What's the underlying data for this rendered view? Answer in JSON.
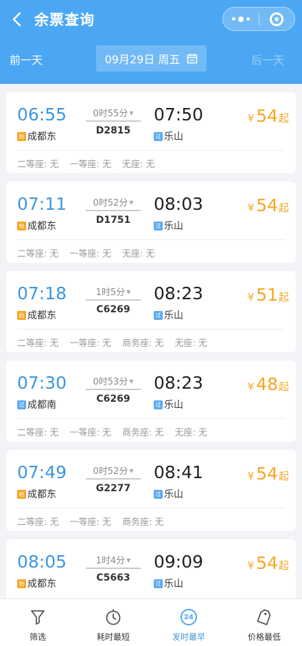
{
  "header": {
    "title": "余票查询",
    "back_icon": "chevron-left-icon",
    "more_icon": "more-dots-icon",
    "close_icon": "target-close-icon"
  },
  "date_nav": {
    "prev_label": "前一天",
    "date_label": "09月29日 周五",
    "calendar_icon": "calendar-icon",
    "next_label": "后一天"
  },
  "trains": [
    {
      "dep_time": "06:55",
      "dep_tag": "始",
      "dep_station": "成都东",
      "duration": "0时55分",
      "train_no": "D2815",
      "arr_time": "07:50",
      "arr_tag": "过",
      "arr_station": "乐山",
      "price_symbol": "¥",
      "price": "54",
      "price_suffix": "起",
      "seats": [
        "二等座: 无",
        "一等座: 无",
        "无座: 无"
      ]
    },
    {
      "dep_time": "07:11",
      "dep_tag": "始",
      "dep_station": "成都东",
      "duration": "0时52分",
      "train_no": "D1751",
      "arr_time": "08:03",
      "arr_tag": "过",
      "arr_station": "乐山",
      "price_symbol": "¥",
      "price": "54",
      "price_suffix": "起",
      "seats": [
        "二等座: 无",
        "一等座: 无",
        "无座: 无"
      ]
    },
    {
      "dep_time": "07:18",
      "dep_tag": "始",
      "dep_station": "成都东",
      "duration": "1时5分",
      "train_no": "C6269",
      "arr_time": "08:23",
      "arr_tag": "过",
      "arr_station": "乐山",
      "price_symbol": "¥",
      "price": "51",
      "price_suffix": "起",
      "seats": [
        "二等座: 无",
        "一等座: 无",
        "商务座: 无",
        "无座: 无"
      ]
    },
    {
      "dep_time": "07:30",
      "dep_tag": "过",
      "dep_station": "成都南",
      "duration": "0时53分",
      "train_no": "C6269",
      "arr_time": "08:23",
      "arr_tag": "过",
      "arr_station": "乐山",
      "price_symbol": "¥",
      "price": "48",
      "price_suffix": "起",
      "seats": [
        "二等座: 无",
        "一等座: 无",
        "商务座: 无",
        "无座: 无"
      ]
    },
    {
      "dep_time": "07:49",
      "dep_tag": "始",
      "dep_station": "成都东",
      "duration": "0时52分",
      "train_no": "G2277",
      "arr_time": "08:41",
      "arr_tag": "过",
      "arr_station": "乐山",
      "price_symbol": "¥",
      "price": "54",
      "price_suffix": "起",
      "seats": [
        "二等座: 无",
        "一等座: 无",
        "商务座: 无"
      ]
    },
    {
      "dep_time": "08:05",
      "dep_tag": "始",
      "dep_station": "成都东",
      "duration": "1时4分",
      "train_no": "C5663",
      "arr_time": "09:09",
      "arr_tag": "过",
      "arr_station": "乐山",
      "price_symbol": "¥",
      "price": "54",
      "price_suffix": "起",
      "seats": []
    }
  ],
  "tabbar": {
    "filter_label": "筛选",
    "filter_icon": "funnel-icon",
    "shortest_label": "耗时最短",
    "shortest_icon": "stopwatch-icon",
    "earliest_label": "发时最早",
    "earliest_icon": "clock-24-icon",
    "earliest_badge": "24",
    "cheapest_label": "价格最低",
    "cheapest_icon": "price-tag-icon"
  },
  "colors": {
    "header_bg": "#4ba7f3",
    "time_blue": "#3d96dc",
    "price_orange": "#f5a623",
    "tag_start": "#f5a623",
    "tag_pass": "#5aaaf0"
  }
}
